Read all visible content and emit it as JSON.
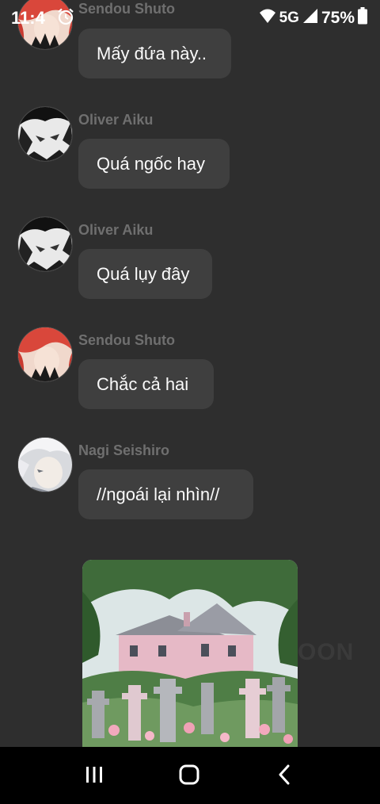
{
  "status_bar": {
    "time": "11:4",
    "network": "5G",
    "battery": "75%"
  },
  "messages": [
    {
      "sender": "Sendou Shuto",
      "text": "Mấy đứa này.."
    },
    {
      "sender": "Oliver Aiku",
      "text": "Quá ngốc hay"
    },
    {
      "sender": "Oliver Aiku",
      "text": "Quá lụy đây"
    },
    {
      "sender": "Sendou Shuto",
      "text": "Chắc cả hai"
    },
    {
      "sender": "Nagi Seishiro",
      "text": "//ngoái lại nhìn//"
    }
  ],
  "watermark": "OON",
  "icons": {
    "alarm": "alarm-icon",
    "wifi": "wifi-icon",
    "signal": "signal-icon",
    "battery": "battery-icon",
    "recents": "recents-icon",
    "home": "home-icon",
    "back": "back-icon"
  },
  "colors": {
    "background": "#2e2e2e",
    "bubble": "#3f3f3f",
    "sender": "#6f6f6f",
    "navbar": "#000000"
  }
}
